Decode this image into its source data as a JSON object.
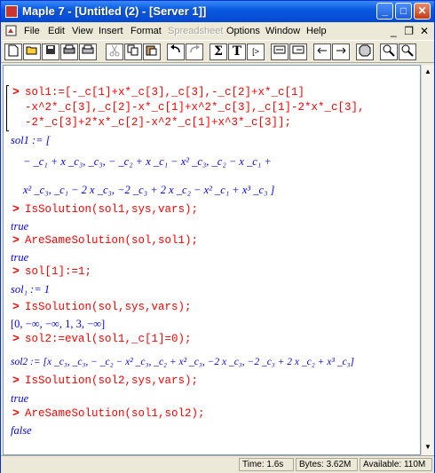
{
  "window": {
    "title": "Maple 7 - [Untitled (2) - [Server 1]]"
  },
  "titlebar_buttons": {
    "minimize": "_",
    "maximize": "□",
    "close": "✕"
  },
  "menu": [
    {
      "label": "File",
      "disabled": false
    },
    {
      "label": "Edit",
      "disabled": false
    },
    {
      "label": "View",
      "disabled": false
    },
    {
      "label": "Insert",
      "disabled": false
    },
    {
      "label": "Format",
      "disabled": false
    },
    {
      "label": "Spreadsheet",
      "disabled": true
    },
    {
      "label": "Options",
      "disabled": false
    },
    {
      "label": "Window",
      "disabled": false
    },
    {
      "label": "Help",
      "disabled": false
    }
  ],
  "mdi_buttons": {
    "minimize": "_",
    "restore": "❐",
    "close": "✕"
  },
  "toolbar": {
    "sigma": "Σ",
    "text": "T",
    "exec": "[>"
  },
  "worksheet": {
    "cmd1": {
      "prompt": ">",
      "lines": [
        "sol1:=[-_c[1]+x*_c[3],_c[3],-_c[2]+x*_c[1]",
        "-x^2*_c[3],_c[2]-x*_c[1]+x^2*_c[3],_c[1]-2*x*_c[3],",
        "-2*_c[3]+2*x*_c[2]-x^2*_c[1]+x^3*_c[3]];"
      ]
    },
    "out1": {
      "head": "sol1 := [",
      "line1": "− _c₁ + x _c₃, _c₃, − _c₂ + x _c₁ − x² _c₃, _c₂ − x _c₁ +",
      "line2": "x² _c₃, _c₁ − 2 x _c₃, −2 _c₃ + 2 x _c₂ − x² _c₁ + x³ _c₃ ]"
    },
    "cmd2": {
      "prompt": ">",
      "text": "IsSolution(sol1,sys,vars);"
    },
    "out2": "true",
    "cmd3": {
      "prompt": ">",
      "text": "AreSameSolution(sol,sol1);"
    },
    "out3": "true",
    "cmd4": {
      "prompt": ">",
      "text": "sol[1]:=1;"
    },
    "out4": "sol₁ := 1",
    "cmd5": {
      "prompt": ">",
      "text": "IsSolution(sol,sys,vars);"
    },
    "out5": "[0, −∞, −∞, 1, 3, −∞]",
    "cmd6": {
      "prompt": ">",
      "text": "sol2:=eval(sol1,_c[1]=0);"
    },
    "out6": "sol2 := [x _c₃, _c₃, − _c₂ − x² _c₃, _c₂ + x² _c₃, −2 x _c₃, −2 _c₃ + 2 x _c₂ + x³ _c₃]",
    "cmd7": {
      "prompt": ">",
      "text": "IsSolution(sol2,sys,vars);"
    },
    "out7": "true",
    "cmd8": {
      "prompt": ">",
      "text": "AreSameSolution(sol1,sol2);"
    },
    "out8": "false"
  },
  "status": {
    "time": "Time: 1.6s",
    "bytes": "Bytes: 3.62M",
    "available": "Available: 110M"
  }
}
